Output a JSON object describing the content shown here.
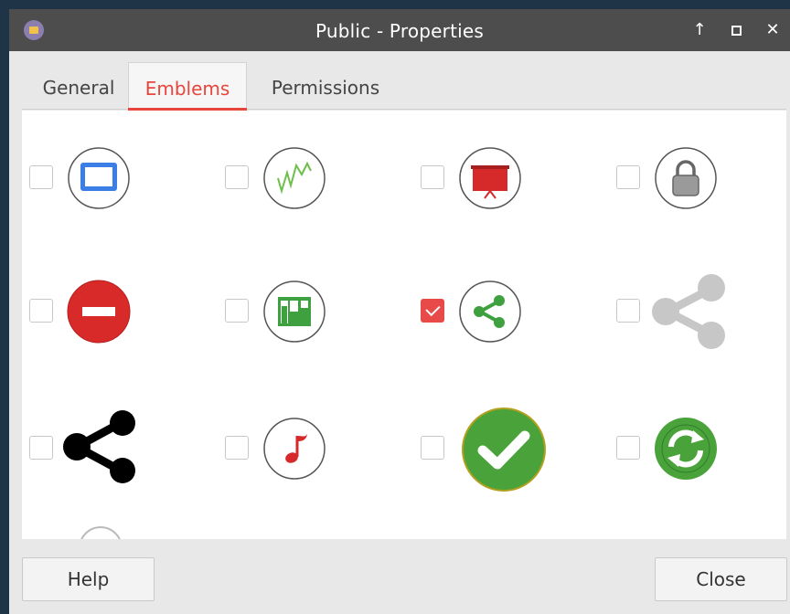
{
  "window": {
    "title": "Public - Properties",
    "controls": {
      "keep_above_icon": "↑",
      "maximize_icon": "maximize",
      "close_icon": "✕"
    }
  },
  "tabs": [
    {
      "label": "General",
      "active": false
    },
    {
      "label": "Emblems",
      "active": true
    },
    {
      "label": "Permissions",
      "active": false
    }
  ],
  "emblems": [
    {
      "icon": "computer-icon",
      "checked": false
    },
    {
      "icon": "graph-line-icon",
      "checked": false
    },
    {
      "icon": "presentation-icon",
      "checked": false
    },
    {
      "icon": "lock-icon",
      "checked": false
    },
    {
      "icon": "no-entry-icon",
      "checked": false
    },
    {
      "icon": "bar-chart-icon",
      "checked": false
    },
    {
      "icon": "share-green-icon",
      "checked": true
    },
    {
      "icon": "share-gray-icon",
      "checked": false
    },
    {
      "icon": "share-black-icon",
      "checked": false
    },
    {
      "icon": "music-note-icon",
      "checked": false
    },
    {
      "icon": "checkmark-icon",
      "checked": false
    },
    {
      "icon": "sync-icon",
      "checked": false
    }
  ],
  "footer": {
    "help_label": "Help",
    "close_label": "Close"
  },
  "colors": {
    "accent": "#e8453c",
    "titlebar": "#4d4d4d",
    "desktop": "#1f3446"
  }
}
